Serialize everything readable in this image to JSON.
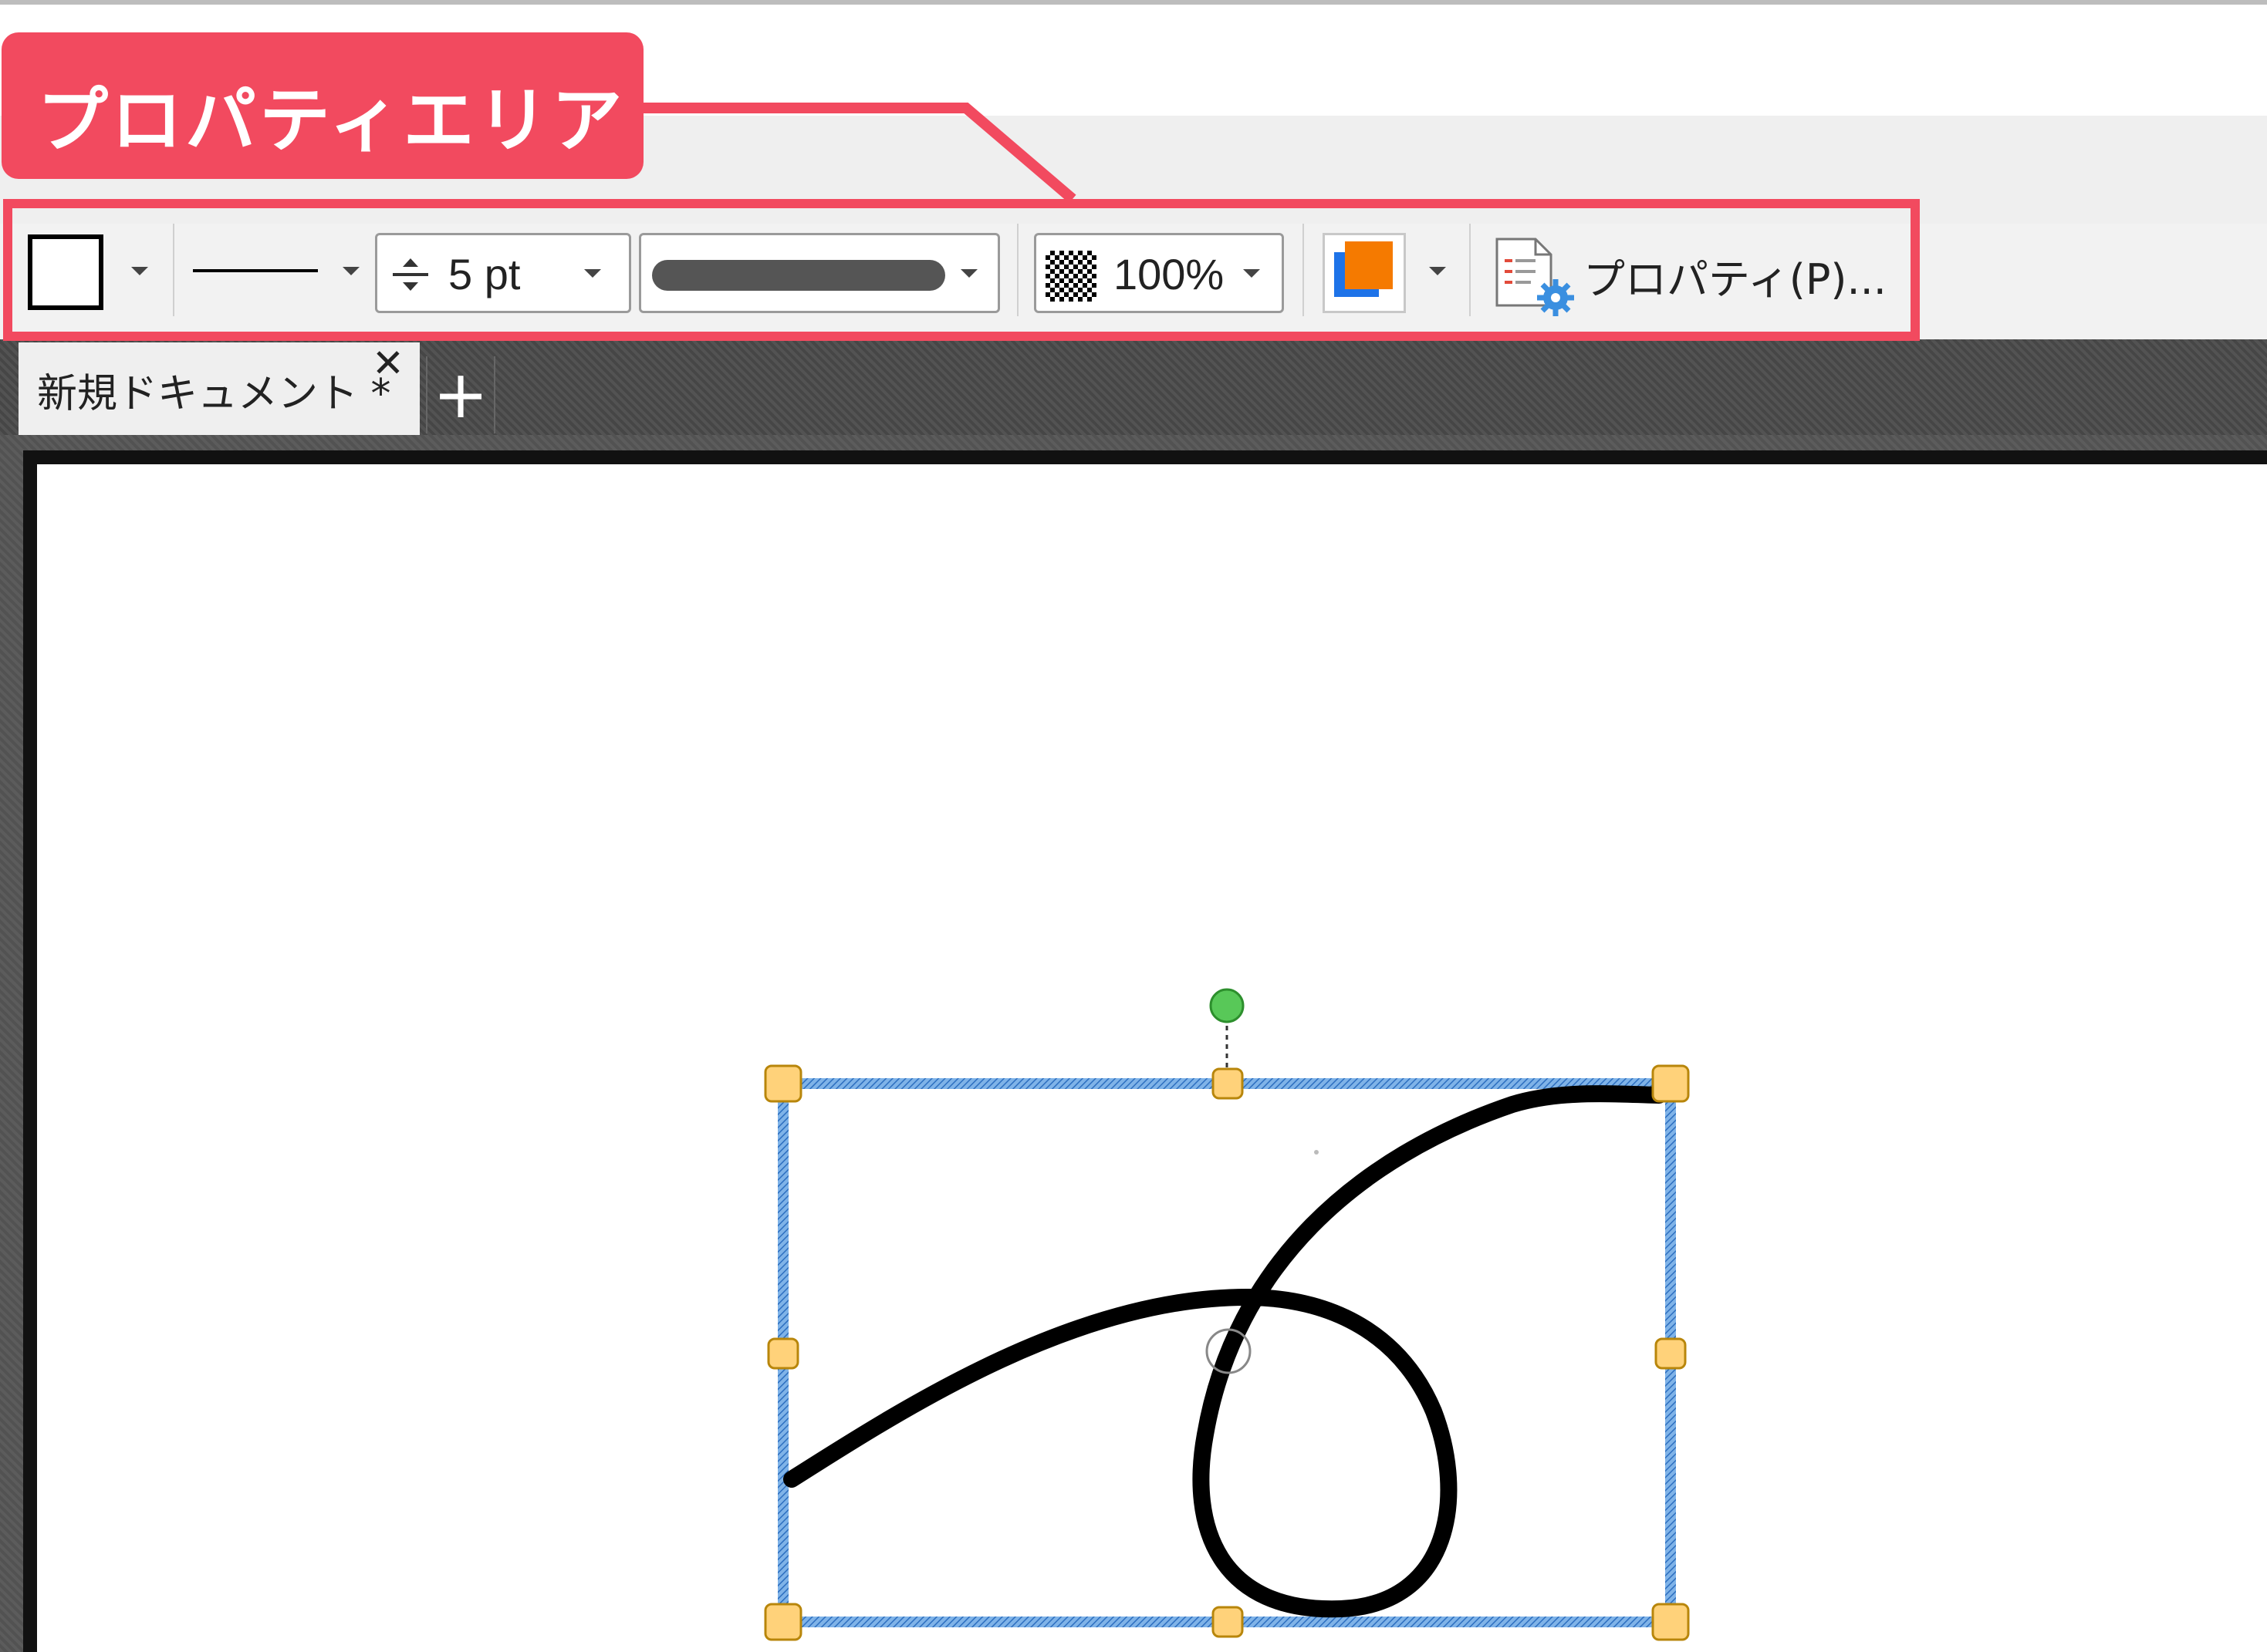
{
  "annotation": {
    "label": "プロパティエリア",
    "color": "#f24a5f"
  },
  "toolbar": {
    "shape_icon": "rectangle-outline-icon",
    "line_icon": "line-style-icon",
    "line_width_icon": "line-width-icon",
    "line_width_value": "5 pt",
    "stroke_style_icon": "stroke-style-preview",
    "opacity_icon": "transparency-checker-icon",
    "opacity_value": "100%",
    "fill_color": "#f57a00",
    "stroke_color": "#1e73e8",
    "properties_label": "プロパティ(P)...",
    "properties_icon": "properties-gear-icon"
  },
  "tabs": [
    {
      "label": "新規ドキュメント *",
      "close": "✕"
    }
  ],
  "new_tab_label": "+",
  "canvas": {
    "selection_color": "#4a90d9",
    "handle_color": "#ffd27a",
    "rotation_handle_color": "#58c858",
    "stroke_color": "#000000"
  }
}
